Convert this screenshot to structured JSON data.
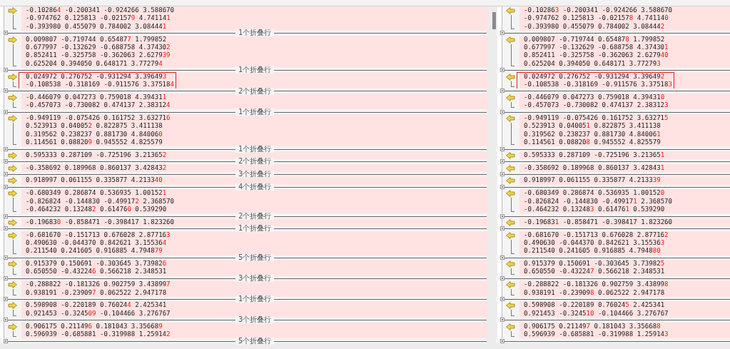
{
  "blocks": [
    {
      "left": [
        [
          {
            "text": "-0.10286",
            "changed": false
          },
          {
            "text": "4",
            "changed": true
          },
          {
            "text": " -0.200341 -0.924266 3.588670",
            "changed": false
          }
        ],
        [
          {
            "text": "-0.974762 0.125813 -0.02157",
            "changed": false
          },
          {
            "text": "9",
            "changed": true
          },
          {
            "text": " 4.74114",
            "changed": false
          },
          {
            "text": "1",
            "changed": true
          }
        ],
        [
          {
            "text": "-0.393980 0.455079 0.784002 3.08444",
            "changed": false
          },
          {
            "text": "1",
            "changed": true
          }
        ]
      ],
      "right": [
        [
          {
            "text": "-0.10286",
            "changed": false
          },
          {
            "text": "3",
            "changed": true
          },
          {
            "text": " -0.200341 -0.924266 3.588670",
            "changed": false
          }
        ],
        [
          {
            "text": "-0.974762 0.125813 -0.02157",
            "changed": false
          },
          {
            "text": "8",
            "changed": true
          },
          {
            "text": " 4.74114",
            "changed": false
          },
          {
            "text": "0",
            "changed": true
          }
        ],
        [
          {
            "text": "-0.393980 0.455079 0.784002 3.08444",
            "changed": false
          },
          {
            "text": "2",
            "changed": true
          }
        ]
      ],
      "annotated": false,
      "fold_label": "1个折叠行"
    },
    {
      "left": [
        [
          {
            "text": "0.009807 -0.719744 0.65487",
            "changed": false
          },
          {
            "text": "7",
            "changed": true
          },
          {
            "text": " 1.799852",
            "changed": false
          }
        ],
        [
          {
            "text": "0.677997 -0.132629 -0.688758 4.37430",
            "changed": false
          },
          {
            "text": "2",
            "changed": true
          }
        ],
        [
          {
            "text": "0.852411 -0.325758 -0.362063 2.6279",
            "changed": false
          },
          {
            "text": "39",
            "changed": true
          }
        ],
        [
          {
            "text": "0.625204 0.394050 0.648171 3.77279",
            "changed": false
          },
          {
            "text": "4",
            "changed": true
          }
        ]
      ],
      "right": [
        [
          {
            "text": "0.009807 -0.719744 0.65487",
            "changed": false
          },
          {
            "text": "8",
            "changed": true
          },
          {
            "text": " 1.799852",
            "changed": false
          }
        ],
        [
          {
            "text": "0.677997 -0.132629 -0.688758 4.37430",
            "changed": false
          },
          {
            "text": "1",
            "changed": true
          }
        ],
        [
          {
            "text": "0.852411 -0.325758 -0.362063 2.6279",
            "changed": false
          },
          {
            "text": "40",
            "changed": true
          }
        ],
        [
          {
            "text": "0.625204 0.394050 0.648171 3.77279",
            "changed": false
          },
          {
            "text": "3",
            "changed": true
          }
        ]
      ],
      "annotated": false,
      "fold_label": "1个折叠行"
    },
    {
      "left": [
        [
          {
            "text": "0.024972 0.276752 -0.931294 3.39649",
            "changed": false
          },
          {
            "text": "3",
            "changed": true
          }
        ],
        [
          {
            "text": "-0.108538 -0.318169 -0.911576 3.37518",
            "changed": false
          },
          {
            "text": "4",
            "changed": true
          }
        ]
      ],
      "right": [
        [
          {
            "text": "0.024972 0.276752 -0.931294 3.39649",
            "changed": false
          },
          {
            "text": "2",
            "changed": true
          }
        ],
        [
          {
            "text": "-0.108538 -0.318169 -0.911576 3.37518",
            "changed": false
          },
          {
            "text": "3",
            "changed": true
          }
        ]
      ],
      "annotated": true,
      "fold_label": "2个折叠行"
    },
    {
      "left": [
        [
          {
            "text": "-0.446079 0.047273 0.759018 4.39431",
            "changed": false
          },
          {
            "text": "1",
            "changed": true
          }
        ],
        [
          {
            "text": "-0.457073 -0.730082 0.474137 2.38312",
            "changed": false
          },
          {
            "text": "4",
            "changed": true
          }
        ]
      ],
      "right": [
        [
          {
            "text": "-0.446079 0.047273 0.759018 4.39431",
            "changed": false
          },
          {
            "text": "0",
            "changed": true
          }
        ],
        [
          {
            "text": "-0.457073 -0.730082 0.474137 2.38312",
            "changed": false
          },
          {
            "text": "3",
            "changed": true
          }
        ]
      ],
      "annotated": false,
      "fold_label": "1个折叠行"
    },
    {
      "left": [
        [
          {
            "text": "-0.949119 -0.075426 0.161752 3.63271",
            "changed": false
          },
          {
            "text": "6",
            "changed": true
          }
        ],
        [
          {
            "text": "0.523913 0.04005",
            "changed": false
          },
          {
            "text": "2",
            "changed": true
          },
          {
            "text": " 0.822875 3.411138",
            "changed": false
          }
        ],
        [
          {
            "text": "0.319562 0.238237 0.881730 4.84006",
            "changed": false
          },
          {
            "text": "0",
            "changed": true
          }
        ],
        [
          {
            "text": "0.114561 0.08820",
            "changed": false
          },
          {
            "text": "9",
            "changed": true
          },
          {
            "text": " 0.945552 4.825579",
            "changed": false
          }
        ]
      ],
      "right": [
        [
          {
            "text": "-0.949119 -0.075426 0.161752 3.63271",
            "changed": false
          },
          {
            "text": "5",
            "changed": true
          }
        ],
        [
          {
            "text": "0.523913 0.04005",
            "changed": false
          },
          {
            "text": "1",
            "changed": true
          },
          {
            "text": " 0.822875 3.411138",
            "changed": false
          }
        ],
        [
          {
            "text": "0.319562 0.238237 0.881730 4.84006",
            "changed": false
          },
          {
            "text": "1",
            "changed": true
          }
        ],
        [
          {
            "text": "0.114561 0.08820",
            "changed": false
          },
          {
            "text": "8",
            "changed": true
          },
          {
            "text": " 0.945552 4.825579",
            "changed": false
          }
        ]
      ],
      "annotated": false,
      "fold_label": "1个折叠行"
    },
    {
      "left": [
        [
          {
            "text": "0.595333 0.287109 -0.725196 3.21365",
            "changed": false
          },
          {
            "text": "2",
            "changed": true
          }
        ]
      ],
      "right": [
        [
          {
            "text": "0.595333 0.287109 -0.725196 3.21365",
            "changed": false
          },
          {
            "text": "1",
            "changed": true
          }
        ]
      ],
      "annotated": false,
      "fold_label": "2个折叠行"
    },
    {
      "left": [
        [
          {
            "text": "-0.358692 0.189968 0.860137 3.42843",
            "changed": false
          },
          {
            "text": "2",
            "changed": true
          }
        ]
      ],
      "right": [
        [
          {
            "text": "-0.358692 0.189968 0.860137 3.42843",
            "changed": false
          },
          {
            "text": "1",
            "changed": true
          }
        ]
      ],
      "annotated": false,
      "fold_label": "3个折叠行"
    },
    {
      "left": [
        [
          {
            "text": "0.918997 0.061155 0.335877 4.2133",
            "changed": false
          },
          {
            "text": "40",
            "changed": true
          }
        ]
      ],
      "right": [
        [
          {
            "text": "0.918997 0.061155 0.335877 4.2133",
            "changed": false
          },
          {
            "text": "39",
            "changed": true
          }
        ]
      ],
      "annotated": false,
      "fold_label": "4个折叠行"
    },
    {
      "left": [
        [
          {
            "text": "-0.680349 0.286874 0.536935 1.00152",
            "changed": false
          },
          {
            "text": "1",
            "changed": true
          }
        ],
        [
          {
            "text": "-0.826824 -0.144830 -0.49917",
            "changed": false
          },
          {
            "text": "2",
            "changed": true
          },
          {
            "text": " 2.368570",
            "changed": false
          }
        ],
        [
          {
            "text": "-0.464232 0.13248",
            "changed": false
          },
          {
            "text": "2",
            "changed": true
          },
          {
            "text": " 0.61476",
            "changed": false
          },
          {
            "text": "0",
            "changed": true
          },
          {
            "text": " 0.539290",
            "changed": false
          }
        ]
      ],
      "right": [
        [
          {
            "text": "-0.680349 0.286874 0.536935 1.00152",
            "changed": false
          },
          {
            "text": "0",
            "changed": true
          }
        ],
        [
          {
            "text": "-0.826824 -0.144830 -0.49917",
            "changed": false
          },
          {
            "text": "1",
            "changed": true
          },
          {
            "text": " 2.368570",
            "changed": false
          }
        ],
        [
          {
            "text": "-0.464232 0.13248",
            "changed": false
          },
          {
            "text": "3",
            "changed": true
          },
          {
            "text": " 0.61476",
            "changed": false
          },
          {
            "text": "1",
            "changed": true
          },
          {
            "text": " 0.539290",
            "changed": false
          }
        ]
      ],
      "annotated": false,
      "fold_label": "2个折叠行"
    },
    {
      "left": [
        [
          {
            "text": "-0.19683",
            "changed": false
          },
          {
            "text": "0",
            "changed": true
          },
          {
            "text": " -0.858471 -0.398417 1.823260",
            "changed": false
          }
        ]
      ],
      "right": [
        [
          {
            "text": "-0.19683",
            "changed": false
          },
          {
            "text": "1",
            "changed": true
          },
          {
            "text": " -0.858471 -0.398417 1.823260",
            "changed": false
          }
        ]
      ],
      "annotated": false,
      "fold_label": "1个折叠行"
    },
    {
      "left": [
        [
          {
            "text": "-0.681670 -0.151713 0.676028 2.87716",
            "changed": false
          },
          {
            "text": "3",
            "changed": true
          }
        ],
        [
          {
            "text": "0.490630 -0.044370 0.842621 3.15536",
            "changed": false
          },
          {
            "text": "4",
            "changed": true
          }
        ],
        [
          {
            "text": "0.211540 0.241605 0.916885 4.7948",
            "changed": false
          },
          {
            "text": "79",
            "changed": true
          }
        ]
      ],
      "right": [
        [
          {
            "text": "-0.681670 -0.151713 0.676028 2.87716",
            "changed": false
          },
          {
            "text": "2",
            "changed": true
          }
        ],
        [
          {
            "text": "0.490630 -0.044370 0.842621 3.15536",
            "changed": false
          },
          {
            "text": "3",
            "changed": true
          }
        ],
        [
          {
            "text": "0.211540 0.241605 0.916885 4.7948",
            "changed": false
          },
          {
            "text": "80",
            "changed": true
          }
        ]
      ],
      "annotated": false,
      "fold_label": "5个折叠行"
    },
    {
      "left": [
        [
          {
            "text": "0.915379 0.150691 -0.303645 3.73982",
            "changed": false
          },
          {
            "text": "6",
            "changed": true
          }
        ],
        [
          {
            "text": "0.650550 -0.43224",
            "changed": false
          },
          {
            "text": "6",
            "changed": true
          },
          {
            "text": " 0.566218 2.348531",
            "changed": false
          }
        ]
      ],
      "right": [
        [
          {
            "text": "0.915379 0.150691 -0.303645 3.73982",
            "changed": false
          },
          {
            "text": "5",
            "changed": true
          }
        ],
        [
          {
            "text": "0.650550 -0.43224",
            "changed": false
          },
          {
            "text": "7",
            "changed": true
          },
          {
            "text": " 0.566218 2.348531",
            "changed": false
          }
        ]
      ],
      "annotated": false,
      "fold_label": "3个折叠行"
    },
    {
      "left": [
        [
          {
            "text": "-0.288822 -0.181326 0.902759 3.43899",
            "changed": false
          },
          {
            "text": "7",
            "changed": true
          }
        ],
        [
          {
            "text": "0.938191 -0.23909",
            "changed": false
          },
          {
            "text": "7",
            "changed": true
          },
          {
            "text": " 0.062522 2.947178",
            "changed": false
          }
        ]
      ],
      "right": [
        [
          {
            "text": "-0.288822 -0.181326 0.902759 3.43899",
            "changed": false
          },
          {
            "text": "8",
            "changed": true
          }
        ],
        [
          {
            "text": "0.938191 -0.23909",
            "changed": false
          },
          {
            "text": "8",
            "changed": true
          },
          {
            "text": " 0.062522 2.947178",
            "changed": false
          }
        ]
      ],
      "annotated": false,
      "fold_label": "1个折叠行"
    },
    {
      "left": [
        [
          {
            "text": "0.598908 -0.220189 0.76024",
            "changed": false
          },
          {
            "text": "4",
            "changed": true
          },
          {
            "text": " 2.425341",
            "changed": false
          }
        ],
        [
          {
            "text": "0.921453 -0.3245",
            "changed": false
          },
          {
            "text": "09",
            "changed": true
          },
          {
            "text": " -0.104466 3.276767",
            "changed": false
          }
        ]
      ],
      "right": [
        [
          {
            "text": "0.598908 -0.220189 0.76024",
            "changed": false
          },
          {
            "text": "5",
            "changed": true
          },
          {
            "text": " 2.425341",
            "changed": false
          }
        ],
        [
          {
            "text": "0.921453 -0.3245",
            "changed": false
          },
          {
            "text": "10",
            "changed": true
          },
          {
            "text": " -0.104466 3.276767",
            "changed": false
          }
        ]
      ],
      "annotated": false,
      "fold_label": "3个折叠行"
    },
    {
      "left": [
        [
          {
            "text": "0.906175 0.21149",
            "changed": false
          },
          {
            "text": "6",
            "changed": true
          },
          {
            "text": " 0.181043 3.35668",
            "changed": false
          },
          {
            "text": "9",
            "changed": true
          }
        ],
        [
          {
            "text": "0.596939 -0.685881 -0.319988 1.25914",
            "changed": false
          },
          {
            "text": "2",
            "changed": true
          }
        ]
      ],
      "right": [
        [
          {
            "text": "0.906175 0.21149",
            "changed": false
          },
          {
            "text": "7",
            "changed": true
          },
          {
            "text": " 0.181043 3.35668",
            "changed": false
          },
          {
            "text": "8",
            "changed": true
          }
        ],
        [
          {
            "text": "0.596939 -0.685881 -0.319988 1.25914",
            "changed": false
          },
          {
            "text": "3",
            "changed": true
          }
        ]
      ],
      "annotated": false,
      "fold_label": "5个折叠行"
    }
  ]
}
